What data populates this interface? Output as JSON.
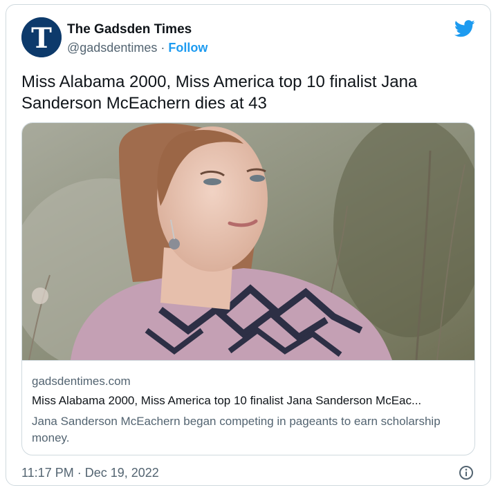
{
  "account": {
    "name": "The Gadsden Times",
    "handle": "@gadsdentimes",
    "separator": "·",
    "follow_label": "Follow",
    "avatar_icon": "gadsden-times-t-logo",
    "avatar_letter": "T"
  },
  "tweet": {
    "text": "Miss Alabama 2000, Miss America top 10 finalist Jana Sanderson McEachern dies at 43",
    "timestamp": "11:17 PM · Dec 19, 2022"
  },
  "link_card": {
    "domain": "gadsdentimes.com",
    "title": "Miss Alabama 2000, Miss America top 10 finalist Jana Sanderson McEac...",
    "description": "Jana Sanderson McEachern began competing in pageants to earn scholarship money.",
    "image_icon": "article-photo"
  },
  "icons": {
    "platform": "twitter-bird-icon",
    "info": "info-icon"
  },
  "colors": {
    "brand_blue": "#1d9bf0",
    "avatar_navy": "#0d3a6b",
    "text_secondary": "#536471",
    "border": "#cfd9de"
  }
}
